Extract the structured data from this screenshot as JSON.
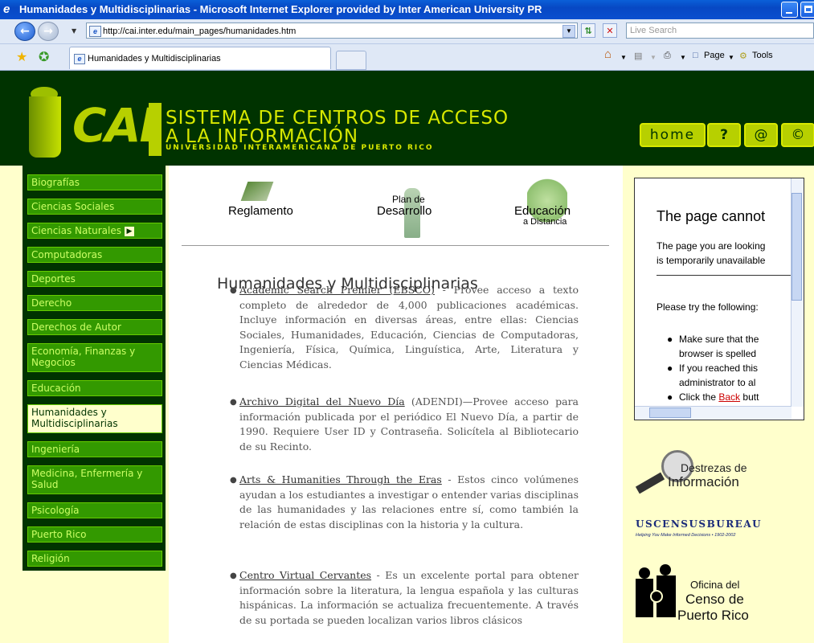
{
  "window": {
    "title": "Humanidades y Multidisciplinarias - Microsoft Internet Explorer provided by Inter American University PR"
  },
  "browser": {
    "address": "http://cai.inter.edu/main_pages/humanidades.htm",
    "search_placeholder": "Live Search",
    "tab_title": "Humanidades y Multidisciplinarias",
    "tools": {
      "page_label": "Page",
      "tools_label": "Tools"
    }
  },
  "header": {
    "logo": "CAI",
    "line1": "SISTEMA DE CENTROS DE ACCESO",
    "line2": "A LA INFORMACIÓN",
    "line3": "UNIVERSIDAD INTERAMERICANA DE PUERTO RICO",
    "buttons": {
      "home": "home",
      "help": "?",
      "email": "@",
      "copyright": "©"
    }
  },
  "sidebar": {
    "items": [
      {
        "label": "Biografías"
      },
      {
        "label": "Ciencias Sociales"
      },
      {
        "label": "Ciencias Naturales"
      },
      {
        "label": "Computadoras"
      },
      {
        "label": "Deportes"
      },
      {
        "label": "Derecho"
      },
      {
        "label": "Derechos de Autor"
      },
      {
        "label": "Economía, Finanzas y Negocios"
      },
      {
        "label": "Educación"
      },
      {
        "label": "Humanidades y Multidisciplinarias"
      },
      {
        "label": "Ingeniería"
      },
      {
        "label": "Medicina, Enfermería y Salud"
      },
      {
        "label": "Psicología"
      },
      {
        "label": "Puerto Rico"
      },
      {
        "label": "Religión"
      }
    ]
  },
  "promos": {
    "reglamento": "Reglamento",
    "plan1": "Plan de",
    "plan2": "Desarrollo",
    "edu1": "Educación",
    "edu2": "a Distancia"
  },
  "main": {
    "title": "Humanidades y Multidisciplinarias",
    "resources": [
      {
        "link": "Academic Search Premier (EBSCO)",
        "text": " - Provee acceso a texto completo de alrededor de 4,000 publicaciones académicas. Incluye información en diversas áreas, entre ellas: Ciencias Sociales, Humanidades, Educación, Ciencias de Computadoras, Ingeniería, Física, Química, Linguística, Arte, Literatura y Ciencias Médicas."
      },
      {
        "link": "Archivo Digital del Nuevo Día",
        "text": " (ADENDI)—Provee acceso para información publicada por el periódico El Nuevo Día, a partir de 1990. Requiere User ID y Contraseña. Solicítela al Bibliotecario de su Recinto."
      },
      {
        "link": "Arts & Humanities Through the Eras",
        "text": " - Estos cinco volúmenes ayudan a los estudiantes a investigar o entender varias disciplinas de las humanidades y las relaciones entre sí, como también la relación de estas disciplinas con la historia y la cultura."
      },
      {
        "link": "Centro Virtual Cervantes",
        "text": " - Es un excelente portal para obtener información sobre la literatura, la lengua española y las culturas hispánicas. La información se actualiza frecuentemente. A través de su portada se pueden localizan varios libros clásicos"
      }
    ]
  },
  "error_frame": {
    "heading": "The page cannot",
    "line1": "The page you are looking",
    "line2": "is temporarily unavailable",
    "try": "Please try the following:",
    "b1a": "Make sure that the",
    "b1b": "browser is spelled",
    "b2a": "If you reached this",
    "b2b": "administrator to al",
    "b3": "Click the",
    "b3link": "Back",
    "b3end": "butt"
  },
  "ads": {
    "destrezas1": "Destrezas de",
    "destrezas2": "Información",
    "census": "USCENSUSBUREAU",
    "census_tag": "Helping You Make Informed Decisions • 1902-2002",
    "oficina1": "Oficina del",
    "oficina2": "Censo de",
    "oficina3": "Puerto Rico"
  }
}
